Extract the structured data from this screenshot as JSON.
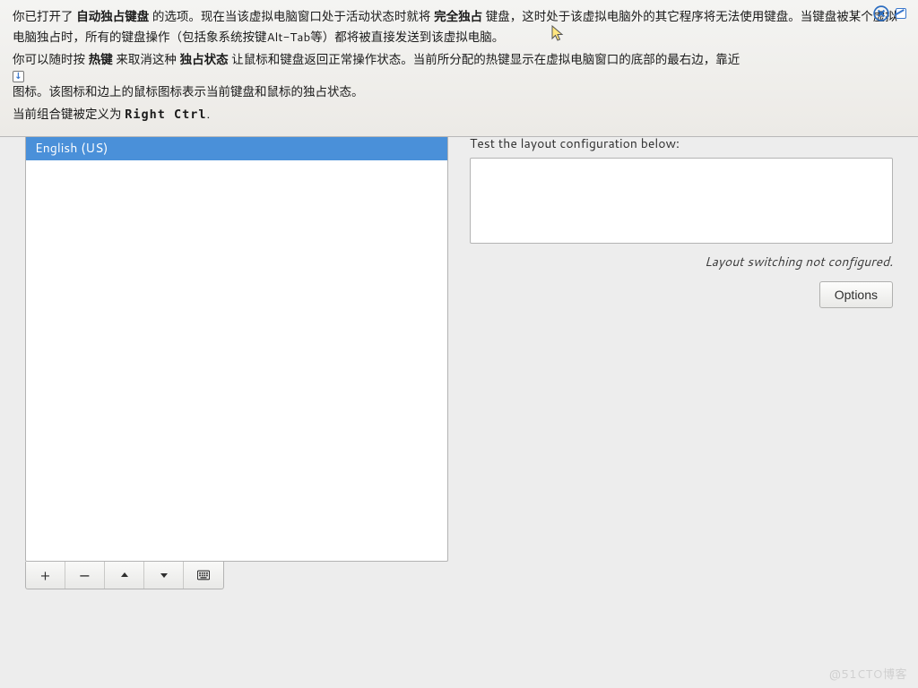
{
  "overlay": {
    "p1_a": "你已打开了 ",
    "p1_b": "自动独占键盘",
    "p1_c": " 的选项。现在当该虚拟电脑窗口处于活动状态时就将 ",
    "p1_d": "完全独占",
    "p1_e": " 键盘，这时处于该虚拟电脑外的其它程序将无法使用键盘。当键盘被某个虚拟电脑独占时，所有的键盘操作（包括象系统按键Alt-Tab等）都将被直接发送到该虚拟电脑。",
    "p2_a": "你可以随时按 ",
    "p2_b": "热键",
    "p2_c": " 来取消这种 ",
    "p2_d": "独占状态",
    "p2_e": " 让鼠标和键盘返回正常操作状态。当前所分配的热键显示在虚拟电脑窗口的底部的最右边，靠近 ",
    "p2_f": " 图标。该图标和边上的鼠标图标表示当前键盘和鼠标的独占状态。",
    "p3_a": "当前组合键被定义为 ",
    "p3_b": "Right Ctrl",
    "p3_c": "."
  },
  "layouts": {
    "items": [
      "English (US)"
    ]
  },
  "toolbar": {
    "add": "+",
    "remove": "−"
  },
  "right": {
    "test_label": "Test the layout configuration below:",
    "switch_note": "Layout switching not configured.",
    "options_label": "Options"
  },
  "watermark": "@51CTO博客",
  "icons": {
    "dl": "↓"
  }
}
